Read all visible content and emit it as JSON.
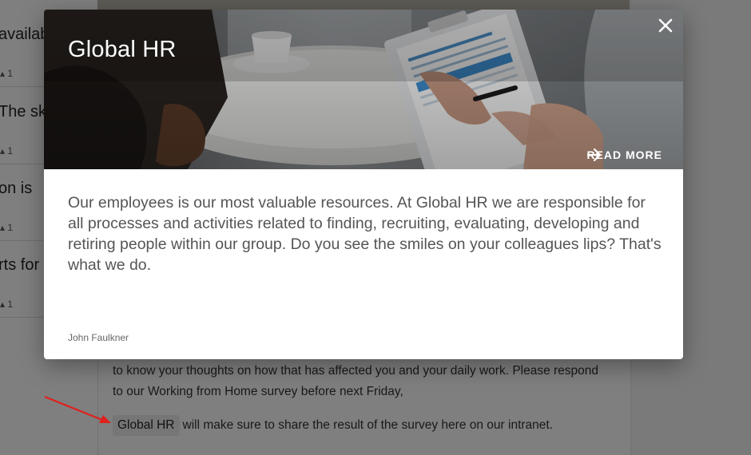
{
  "background": {
    "left_list": [
      {
        "snippet": "availab",
        "likes": "1"
      },
      {
        "snippet": "The sky",
        "likes": "1"
      },
      {
        "snippet": "on is",
        "likes": "1"
      },
      {
        "snippet": "rts for",
        "likes": "1"
      }
    ],
    "article": {
      "line1": "to know your thoughts on how that has affected you and your daily work. Please respond",
      "line2": "to our Working from Home survey before next Friday,",
      "mention": "Global HR",
      "line3_rest": "will make sure to share the result of the survey here on our intranet."
    }
  },
  "modal": {
    "title": "Global HR",
    "read_more": "READ MORE",
    "description": "Our employees is our most valuable resources. At Global HR we are responsible for all processes and activities related to finding, recruiting, evaluating, developing and retiring people within our group. Do you see the smiles on your colleagues lips? That's what we do.",
    "author": "John Faulkner"
  },
  "colors": {
    "overlay": "rgba(0,0,0,0.5)",
    "annotation_arrow": "#e0201c",
    "body_text": "#555555"
  },
  "icons": {
    "close": "close-icon",
    "read_more": "arrow-right-icon",
    "likes": "thumbs-up-icon"
  }
}
